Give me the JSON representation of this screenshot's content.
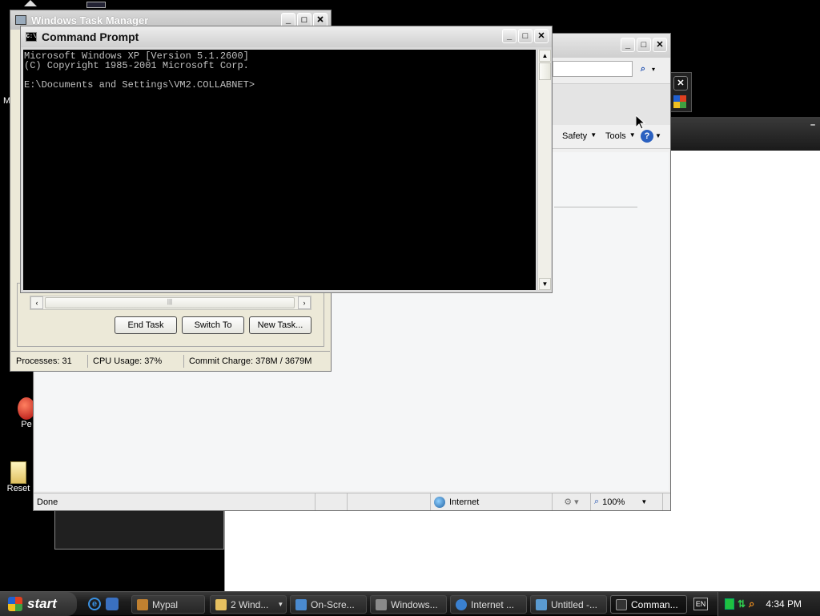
{
  "taskmgr": {
    "title": "Windows Task Manager",
    "buttons": {
      "end_task": "End Task",
      "switch_to": "Switch To",
      "new_task": "New Task..."
    },
    "status": {
      "processes": "Processes: 31",
      "cpu": "CPU Usage: 37%",
      "commit": "Commit Charge: 378M / 3679M"
    }
  },
  "cmd": {
    "title": "Command Prompt",
    "lines": [
      "Microsoft Windows XP [Version 5.1.2600]",
      "(C) Copyright 1985-2001 Microsoft Corp.",
      "",
      "E:\\Documents and Settings\\VM2.COLLABNET>"
    ]
  },
  "ie": {
    "toolbar": {
      "safety": "Safety",
      "tools": "Tools"
    },
    "status": {
      "done": "Done",
      "zone": "Internet",
      "zoom": "100%"
    }
  },
  "desktop": {
    "icon1": "Pe",
    "icon2": "Reset"
  },
  "taskbar": {
    "start": "start",
    "tasks": [
      {
        "label": "Mypal",
        "icon": "mypal-icon",
        "color": "#c08030"
      },
      {
        "label": "2 Wind...",
        "icon": "folder-icon",
        "color": "#e6c060"
      },
      {
        "label": "On-Scre...",
        "icon": "keyboard-icon",
        "color": "#4a8ad0"
      },
      {
        "label": "Windows...",
        "icon": "taskmgr-icon",
        "color": "#8a8a8a"
      },
      {
        "label": "Internet ...",
        "icon": "ie-icon",
        "color": "#3a80d0"
      },
      {
        "label": "Untitled -...",
        "icon": "notepad-icon",
        "color": "#5a9ad0"
      },
      {
        "label": "Comman...",
        "icon": "cmd-icon",
        "color": "#333333"
      }
    ],
    "lang": "EN",
    "clock": "4:34 PM"
  }
}
